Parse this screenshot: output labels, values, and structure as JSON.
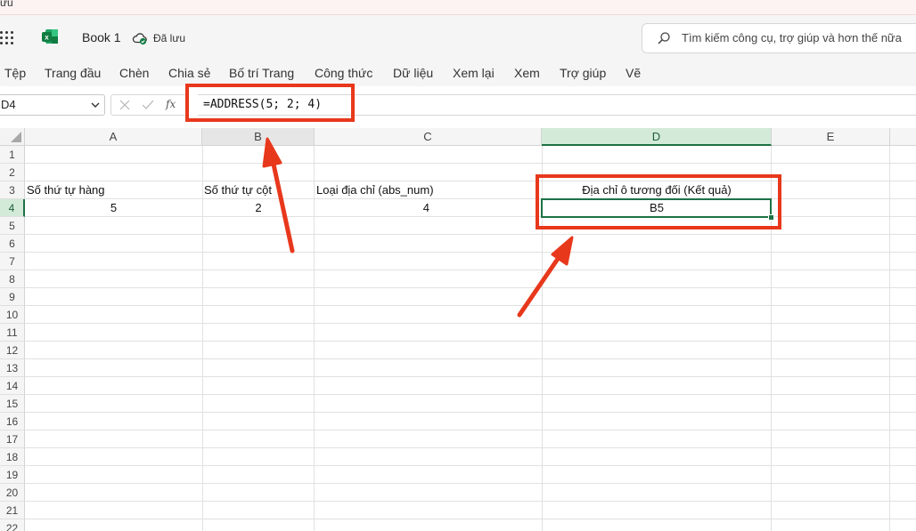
{
  "top_strip_text": "ửu",
  "title_bar": {
    "book_title": "Book 1",
    "save_status": "Đã lưu",
    "search_placeholder": "Tìm kiếm công cụ, trợ giúp và hơn thế nữa"
  },
  "menu": [
    "Tệp",
    "Trang đầu",
    "Chèn",
    "Chia sẻ",
    "Bố trí Trang",
    "Công thức",
    "Dữ liệu",
    "Xem lại",
    "Xem",
    "Trợ giúp",
    "Vẽ"
  ],
  "formula_bar": {
    "name_box": "D4",
    "fx_label": "fx",
    "formula": "=ADDRESS(5; 2; 4)"
  },
  "sheet": {
    "columns": [
      "A",
      "B",
      "C",
      "D",
      "E"
    ],
    "selected_column": "D",
    "rows": [
      "1",
      "2",
      "3",
      "4",
      "5",
      "6",
      "7",
      "8",
      "9",
      "10",
      "11",
      "12",
      "13",
      "14",
      "15",
      "16",
      "17",
      "18",
      "19",
      "20",
      "21",
      "22"
    ],
    "selected_row": "4",
    "cells": {
      "A3": "Số thứ tự hàng",
      "B3": "Số thứ tự cột",
      "C3": "Loại địa chỉ (abs_num)",
      "D3": "Địa chỉ ô tương đối (Kết quả)",
      "A4": "5",
      "B4": "2",
      "C4": "4",
      "D4": "B5"
    }
  },
  "colors": {
    "accent_green": "#1e7145",
    "annotation_red": "#e8381c",
    "excel_green": "#107c41"
  }
}
